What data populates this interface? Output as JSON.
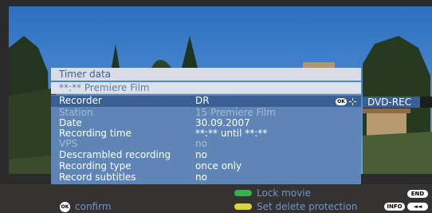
{
  "panel": {
    "title": "Timer data",
    "name": "**:** Premiere Film",
    "rows": [
      {
        "label": "Recorder",
        "value": "DR"
      },
      {
        "label": "Station",
        "value": "15 Premiere Film"
      },
      {
        "label": "Date",
        "value": "30.09.2007"
      },
      {
        "label": "Recording time",
        "value": "**:** until **:**"
      },
      {
        "label": "VPS",
        "value": "no"
      },
      {
        "label": "Descrambled recording",
        "value": "no"
      },
      {
        "label": "Recording type",
        "value": "once only"
      },
      {
        "label": "Record subtitles",
        "value": "no"
      }
    ]
  },
  "recorder_option": "DVD-REC",
  "footer": {
    "confirm": "confirm",
    "lock_movie": "Lock movie",
    "set_delete_protection": "Set delete protection",
    "end_key": "END",
    "info_key": "INFO"
  },
  "icons": {
    "ok": "ok-button-icon",
    "navigate": "navigation-cross-icon",
    "green": "green-button-icon",
    "yellow": "yellow-button-icon",
    "rewind": "rewind-icon"
  },
  "colors": {
    "selected_row": "#3a5f93",
    "panel_body": "#5f85b6",
    "footer_text": "#6f95cc",
    "green_key": "#37b24a",
    "yellow_key": "#d9d23a"
  }
}
